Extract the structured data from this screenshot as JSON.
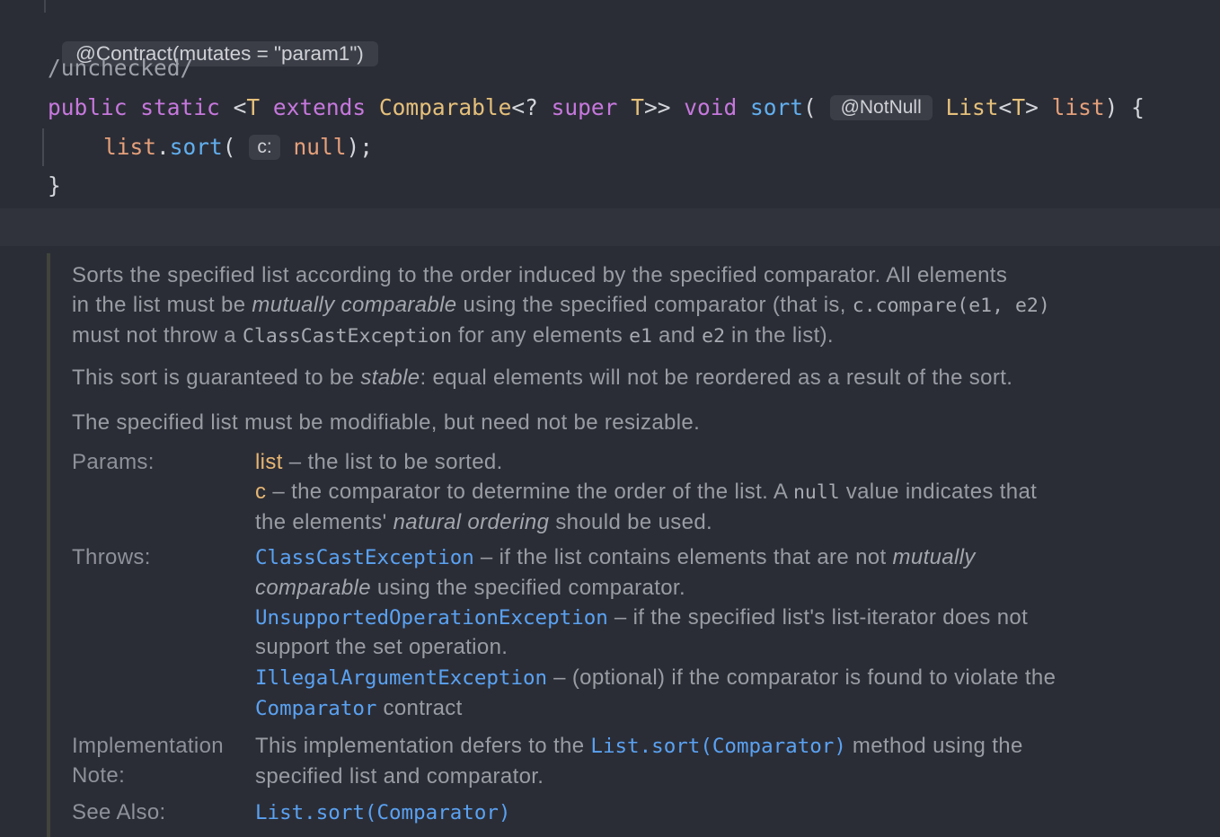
{
  "code": {
    "contract_hint": "@Contract(mutates = \"param1\")",
    "unchecked": "/unchecked/",
    "sig": {
      "public": "public",
      "static": "static",
      "lt": "<",
      "T1": "T",
      "extends": "extends",
      "comparable": "Comparable",
      "wildcard": "<? ",
      "super": "super",
      "T2": "T",
      "close": ">>",
      "void": "void",
      "sort": "sort",
      "paren": "(",
      "notnull_hint": "@NotNull",
      "list_type": "List",
      "lt2": "<",
      "T3": "T",
      "gt2": ">",
      "param": "list",
      "end": ") {"
    },
    "body": {
      "list": "list",
      "dot": ".",
      "sort": "sort",
      "paren": "(",
      "c_hint": "c:",
      "null": "null",
      "end": ");"
    },
    "close_brace": "}"
  },
  "doc": {
    "p1_l1": "Sorts the specified list according to the order induced by the specified comparator. All elements",
    "p1_l2a": "in the list must be ",
    "p1_l2b": "mutually comparable",
    "p1_l2c": " using the specified comparator (that is, ",
    "p1_l2d": "c.compare(e1, e2)",
    "p1_l3a": "must not throw a ",
    "p1_l3b": "ClassCastException",
    "p1_l3c": " for any elements ",
    "p1_l3d": "e1",
    "p1_l3e": " and ",
    "p1_l3f": "e2",
    "p1_l3g": " in the list).",
    "p2a": "This sort is guaranteed to be ",
    "p2b": "stable",
    "p2c": ": equal elements will not be reordered as a result of the sort.",
    "p3": "The specified list must be modifiable, but need not be resizable.",
    "params_label": "Params:",
    "param_list_name": "list",
    "param_list_desc": " – the list to be sorted.",
    "param_c_name": "c",
    "param_c_desc_a": " – the comparator to determine the order of the list. A ",
    "param_c_desc_b": "null",
    "param_c_desc_c": " value indicates that",
    "param_c_l2a": "the elements' ",
    "param_c_l2b": "natural ordering",
    "param_c_l2c": " should be used.",
    "throws_label": "Throws:",
    "t1_link": "ClassCastException",
    "t1_a": " – if the list contains elements that are not ",
    "t1_b": "mutually",
    "t1_l2a": "comparable",
    "t1_l2b": " using the specified comparator.",
    "t2_link": "UnsupportedOperationException",
    "t2_a": " – if the specified list's list-iterator does not",
    "t2_l2": "support the set operation.",
    "t3_link": "IllegalArgumentException",
    "t3_a": " – (optional) if the comparator is found to violate the",
    "t3_l2_link": "Comparator",
    "t3_l2b": " contract",
    "impl_label_1": "Implementation",
    "impl_label_2": "Note:",
    "impl_a": "This implementation defers to the ",
    "impl_link": "List.sort(Comparator)",
    "impl_b": " method using the",
    "impl_l2": "specified list and comparator.",
    "see_label": "See Also:",
    "see_link": "List.sort(Comparator)"
  }
}
